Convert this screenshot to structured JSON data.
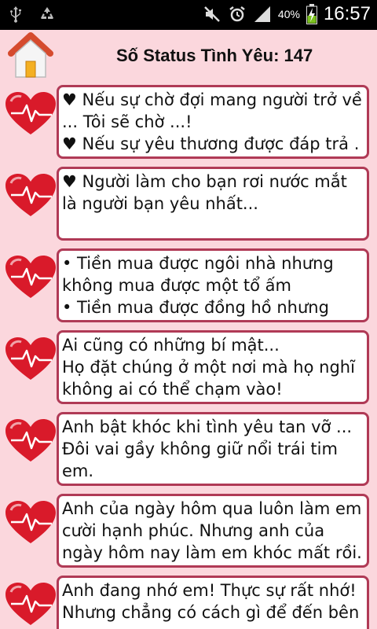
{
  "statusbar": {
    "icons_left": [
      "usb-icon",
      "recycle-icon"
    ],
    "icons_right": [
      "mute-icon",
      "alarm-icon",
      "signal-icon"
    ],
    "battery_percent": "40%",
    "time": "16:57"
  },
  "header": {
    "title": "Số Status Tình Yêu: 147"
  },
  "items": [
    {
      "text": "♥ Nếu sự chờ đợi mang người trở về ... Tôi sẽ chờ ...!\n♥ Nếu sự yêu thương được đáp trả ."
    },
    {
      "text": "♥ Người làm cho bạn rơi nước mắt là người bạn yêu nhất..."
    },
    {
      "text": "• Tiền mua được ngôi nhà nhưng không mua được một tổ ấm\n• Tiền mua được đồng hồ nhưng"
    },
    {
      "text": "Ai cũng có những bí mật...\nHọ đặt chúng ở một nơi mà họ nghĩ không ai có thể chạm vào!"
    },
    {
      "text": "Anh bật khóc khi tình yêu tan vỡ ... Đôi vai gầy không giữ nổi trái tim em."
    },
    {
      "text": "Anh của ngày hôm qua luôn làm em cười hạnh phúc. Nhưng anh của ngày hôm nay làm em khóc mất rồi."
    },
    {
      "text": "Anh đang nhớ em! Thực sự rất nhớ! Nhưng chẳng có cách gì để đến bên"
    }
  ],
  "colors": {
    "background": "#fbd7dd",
    "card_border": "#b03a56",
    "heart": "#d91a2a"
  }
}
